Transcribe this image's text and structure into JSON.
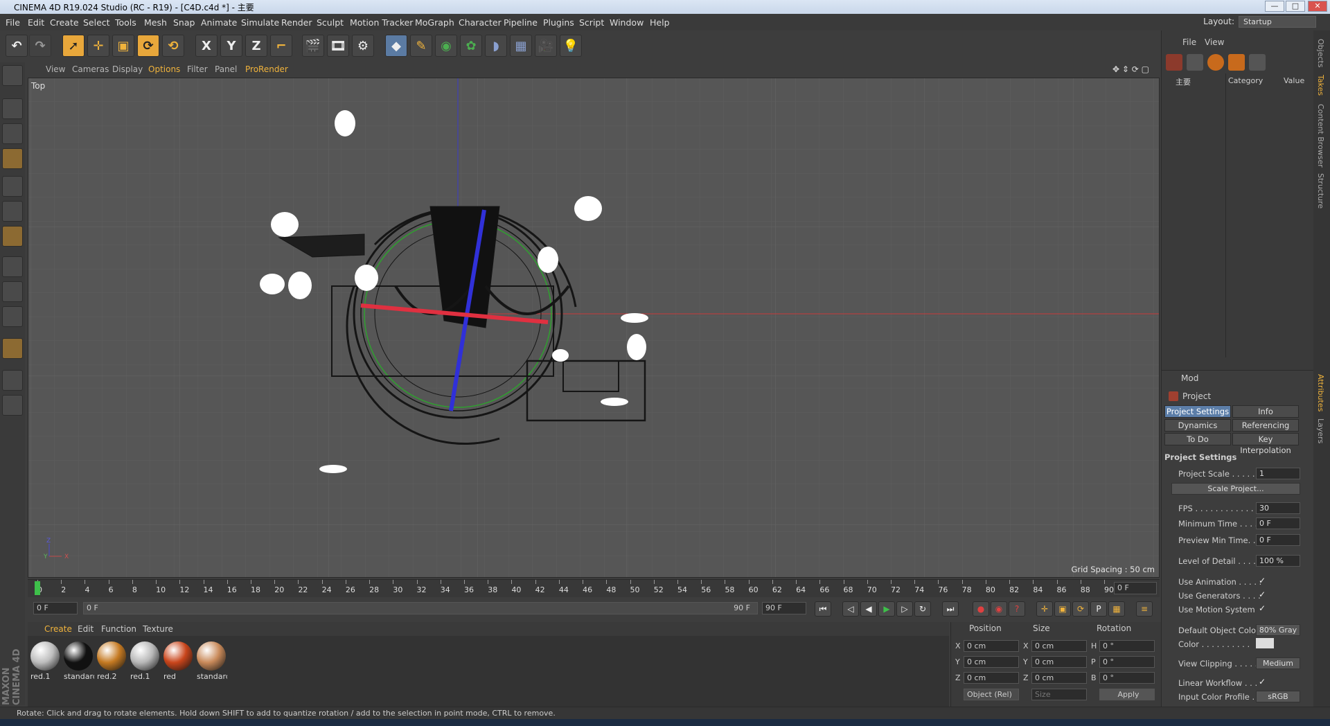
{
  "window": {
    "title": "CINEMA 4D R19.024 Studio (RC - R19) - [C4D.c4d *] - 主要",
    "min": "—",
    "max": "□",
    "close": "✕"
  },
  "menu": [
    "File",
    "Edit",
    "Create",
    "Select",
    "Tools",
    "Mesh",
    "Snap",
    "Animate",
    "Simulate",
    "Render",
    "Sculpt",
    "Motion Tracker",
    "MoGraph",
    "Character",
    "Pipeline",
    "Plugins",
    "Script",
    "Window",
    "Help"
  ],
  "layout": {
    "label": "Layout:",
    "value": "Startup"
  },
  "toolbar": {
    "x": "X",
    "y": "Y",
    "z": "Z"
  },
  "viewport_menu": [
    "View",
    "Cameras",
    "Display",
    "Options",
    "Filter",
    "Panel",
    "ProRender"
  ],
  "viewport": {
    "label": "Top",
    "grid_spacing": "Grid Spacing : 50 cm"
  },
  "timeline": {
    "ticks": [
      "0",
      "2",
      "4",
      "6",
      "8",
      "10",
      "12",
      "14",
      "16",
      "18",
      "20",
      "22",
      "24",
      "26",
      "28",
      "30",
      "32",
      "34",
      "36",
      "38",
      "40",
      "42",
      "44",
      "46",
      "48",
      "50",
      "52",
      "54",
      "56",
      "58",
      "60",
      "62",
      "64",
      "66",
      "68",
      "70",
      "72",
      "74",
      "76",
      "78",
      "80",
      "82",
      "84",
      "86",
      "88",
      "90"
    ],
    "current": "0 F",
    "start": "0 F",
    "range_start": "0 F",
    "range_end": "90 F",
    "end": "90 F"
  },
  "material_menu": [
    "Create",
    "Edit",
    "Function",
    "Texture"
  ],
  "materials": [
    {
      "name": "red.1",
      "color": "#bdbdbd"
    },
    {
      "name": "standard",
      "color": "#111111"
    },
    {
      "name": "red.2",
      "color": "#c57a22"
    },
    {
      "name": "red.1",
      "color": "#b8b8b8"
    },
    {
      "name": "red",
      "color": "#c9451b"
    },
    {
      "name": "standard",
      "color": "#c98a5a"
    }
  ],
  "coords": {
    "position": "Position",
    "size": "Size",
    "rotation": "Rotation",
    "px": "0 cm",
    "py": "0 cm",
    "pz": "0 cm",
    "sx": "0 cm",
    "sy": "0 cm",
    "sz": "0 cm",
    "h": "0 °",
    "p": "0 °",
    "b": "0 °",
    "mode": "Object (Rel)",
    "size_mode": "Size",
    "apply": "Apply"
  },
  "objects": {
    "menu": [
      "File",
      "View"
    ],
    "tree_item": "主要",
    "category": "Category",
    "value": "Value"
  },
  "vertical_tabs": [
    "Objects",
    "Takes",
    "Content Browser",
    "Structure",
    "Attributes",
    "Layers"
  ],
  "attributes": {
    "mode": "Mod",
    "object": "Project",
    "tabs": [
      "Project Settings",
      "Info",
      "Dynamics",
      "Referencing",
      "To Do",
      "Key Interpolation"
    ],
    "section": "Project Settings",
    "project_scale": {
      "label": "Project Scale . . . . . .",
      "value": "1"
    },
    "scale_button": "Scale Project...",
    "fps": {
      "label": "FPS . . . . . . . . . . . . . .",
      "value": "30"
    },
    "min_time": {
      "label": "Minimum Time . . . . .",
      "value": "0 F"
    },
    "preview_min": {
      "label": "Preview Min Time. . . .",
      "value": "0 F"
    },
    "lod": {
      "label": "Level of Detail . . . . .",
      "value": "100 %"
    },
    "use_animation": "Use Animation . . . . .",
    "use_generators": "Use Generators . . . .",
    "use_motion": "Use Motion System",
    "default_color": {
      "label": "Default Object Color",
      "value": "80% Gray"
    },
    "color": "Color . . . . . . . . . .",
    "view_clipping": {
      "label": "View Clipping . . . . . .",
      "value": "Medium"
    },
    "linear_workflow": "Linear Workflow . . .",
    "input_profile": {
      "label": "Input Color Profile . .",
      "value": "sRGB"
    },
    "check": "✓"
  },
  "status": "Rotate: Click and drag to rotate elements. Hold down SHIFT to add to quantize rotation / add to the selection in point mode, CTRL to remove.",
  "brand": "MAXON CINEMA 4D"
}
